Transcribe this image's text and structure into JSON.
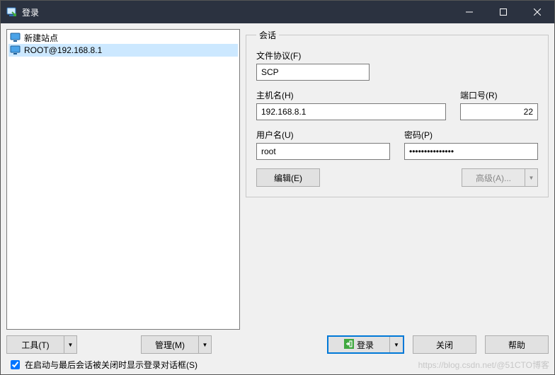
{
  "window": {
    "title": "登录"
  },
  "tree": {
    "items": [
      {
        "label": "新建站点"
      },
      {
        "label": "ROOT@192.168.8.1"
      }
    ]
  },
  "session": {
    "legend": "会话",
    "protocol_label": "文件协议(F)",
    "protocol_value": "SCP",
    "host_label": "主机名(H)",
    "host_value": "192.168.8.1",
    "port_label": "端口号(R)",
    "port_value": "22",
    "user_label": "用户名(U)",
    "user_value": "root",
    "password_label": "密码(P)",
    "password_value": "•••••••••••••••",
    "edit_label": "编辑(E)",
    "advanced_label": "高级(A)..."
  },
  "buttons": {
    "tools": "工具(T)",
    "manage": "管理(M)",
    "login": "登录",
    "close": "关闭",
    "help": "帮助"
  },
  "checkbox": {
    "label": "在启动与最后会话被关闭时显示登录对话框(S)"
  },
  "watermark": "https://blog.csdn.net/@51CTO博客"
}
